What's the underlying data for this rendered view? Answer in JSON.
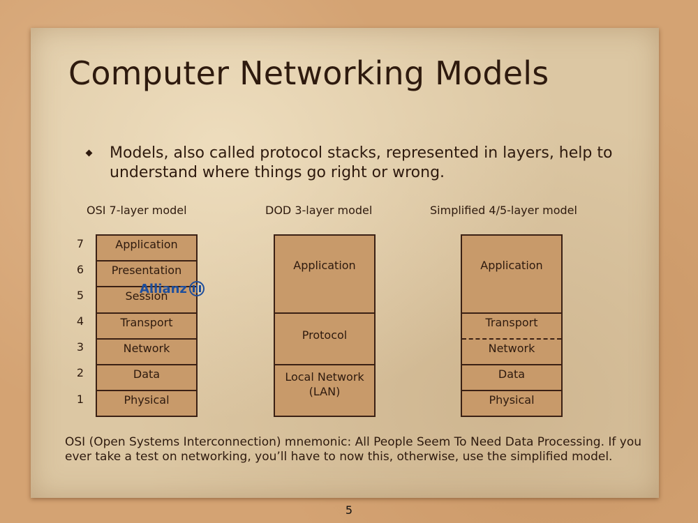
{
  "slide": {
    "title": "Computer Networking Models",
    "bullet": "Models, also called protocol stacks, represented in layers, help to understand where things go right or wrong.",
    "note": "OSI (Open Systems Interconnection) mnemonic: All People Seem To Need Data Processing. If you ever take a test on networking, you’ll have to now this, otherwise, use the simplified model.",
    "page_number": "5"
  },
  "osi": {
    "heading": "OSI 7-layer model",
    "layers": [
      {
        "number": "7",
        "label": "Application"
      },
      {
        "number": "6",
        "label": "Presentation"
      },
      {
        "number": "5",
        "label": "Session"
      },
      {
        "number": "4",
        "label": "Transport"
      },
      {
        "number": "3",
        "label": "Network"
      },
      {
        "number": "2",
        "label": "Data"
      },
      {
        "number": "1",
        "label": "Physical"
      }
    ]
  },
  "dod": {
    "heading": "DOD 3-layer model",
    "layers": [
      {
        "label": "Application"
      },
      {
        "label": "Protocol"
      },
      {
        "label_line1": "Local Network",
        "label_line2": "(LAN)"
      }
    ]
  },
  "simplified": {
    "heading": "Simplified 4/5-layer model",
    "layers": [
      {
        "label": "Application"
      },
      {
        "label": "Transport"
      },
      {
        "label": "Network"
      },
      {
        "label": "Data"
      },
      {
        "label": "Physical"
      }
    ]
  },
  "watermark_logo": {
    "text": "Allianz",
    "color": "#1e4e9c"
  },
  "colors": {
    "box_fill": "#c89a6a",
    "box_border": "#3a2014",
    "text": "#2e1a0e"
  }
}
